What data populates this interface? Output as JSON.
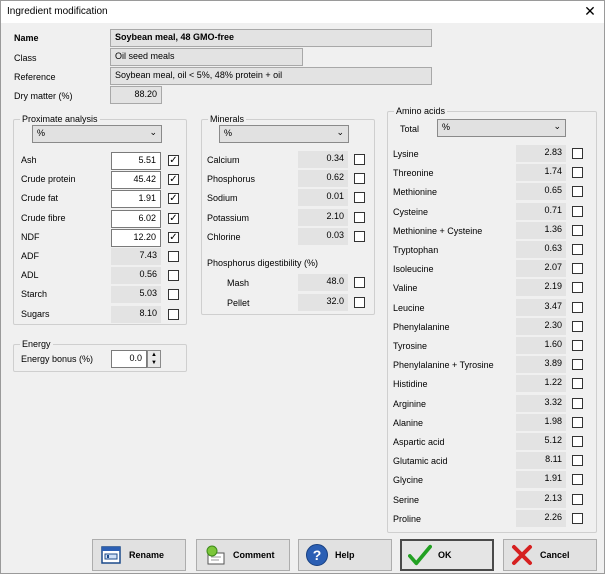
{
  "window": {
    "title": "Ingredient modification",
    "close_symbol": "✕"
  },
  "header": {
    "name_label": "Name",
    "name_value": "Soybean meal, 48 GMO-free",
    "class_label": "Class",
    "class_value": "Oil seed meals",
    "reference_label": "Reference",
    "reference_value": "Soybean meal, oil < 5%, 48% protein + oil",
    "dm_label": "Dry matter (%)",
    "dm_value": "88.20"
  },
  "proximate": {
    "title": "Proximate analysis",
    "unit": "%",
    "items": [
      {
        "label": "Ash",
        "value": "5.51",
        "editable": true,
        "checked": true
      },
      {
        "label": "Crude protein",
        "value": "45.42",
        "editable": true,
        "checked": true
      },
      {
        "label": "Crude fat",
        "value": "1.91",
        "editable": true,
        "checked": true
      },
      {
        "label": "Crude fibre",
        "value": "6.02",
        "editable": true,
        "checked": true
      },
      {
        "label": "NDF",
        "value": "12.20",
        "editable": true,
        "checked": true
      },
      {
        "label": "ADF",
        "value": "7.43",
        "editable": false,
        "checked": false
      },
      {
        "label": "ADL",
        "value": "0.56",
        "editable": false,
        "checked": false
      },
      {
        "label": "Starch",
        "value": "5.03",
        "editable": false,
        "checked": false
      },
      {
        "label": "Sugars",
        "value": "8.10",
        "editable": false,
        "checked": false
      }
    ]
  },
  "energy": {
    "title": "Energy",
    "bonus_label": "Energy bonus (%)",
    "bonus_value": "0.0"
  },
  "minerals": {
    "title": "Minerals",
    "unit": "%",
    "items": [
      {
        "label": "Calcium",
        "value": "0.34"
      },
      {
        "label": "Phosphorus",
        "value": "0.62"
      },
      {
        "label": "Sodium",
        "value": "0.01"
      },
      {
        "label": "Potassium",
        "value": "2.10"
      },
      {
        "label": "Chlorine",
        "value": "0.03"
      }
    ],
    "digestibility_title": "Phosphorus digestibility (%)",
    "digestibility": [
      {
        "label": "Mash",
        "value": "48.0"
      },
      {
        "label": "Pellet",
        "value": "32.0"
      }
    ]
  },
  "amino": {
    "title": "Amino acids",
    "total_label": "Total",
    "unit": "%",
    "items": [
      {
        "label": "Lysine",
        "value": "2.83"
      },
      {
        "label": "Threonine",
        "value": "1.74"
      },
      {
        "label": "Methionine",
        "value": "0.65"
      },
      {
        "label": "Cysteine",
        "value": "0.71"
      },
      {
        "label": "Methionine + Cysteine",
        "value": "1.36"
      },
      {
        "label": "Tryptophan",
        "value": "0.63"
      },
      {
        "label": "Isoleucine",
        "value": "2.07"
      },
      {
        "label": "Valine",
        "value": "2.19"
      },
      {
        "label": "Leucine",
        "value": "3.47"
      },
      {
        "label": "Phenylalanine",
        "value": "2.30"
      },
      {
        "label": "Tyrosine",
        "value": "1.60"
      },
      {
        "label": "Phenylalanine + Tyrosine",
        "value": "3.89"
      },
      {
        "label": "Histidine",
        "value": "1.22"
      },
      {
        "label": "Arginine",
        "value": "3.32"
      },
      {
        "label": "Alanine",
        "value": "1.98"
      },
      {
        "label": "Aspartic acid",
        "value": "5.12"
      },
      {
        "label": "Glutamic acid",
        "value": "8.11"
      },
      {
        "label": "Glycine",
        "value": "1.91"
      },
      {
        "label": "Serine",
        "value": "2.13"
      },
      {
        "label": "Proline",
        "value": "2.26"
      }
    ]
  },
  "buttons": {
    "rename": "Rename",
    "comment": "Comment",
    "help": "Help",
    "ok": "OK",
    "cancel": "Cancel",
    "help_glyph": "?",
    "check_glyph": "✓",
    "chevron": "⌄",
    "spin_up": "▲",
    "spin_down": "▼"
  },
  "colors": {
    "help_blue": "#2b5fb4",
    "ok_green": "#22a022",
    "cancel_red": "#d62020",
    "comment_green": "#7cc63a"
  }
}
